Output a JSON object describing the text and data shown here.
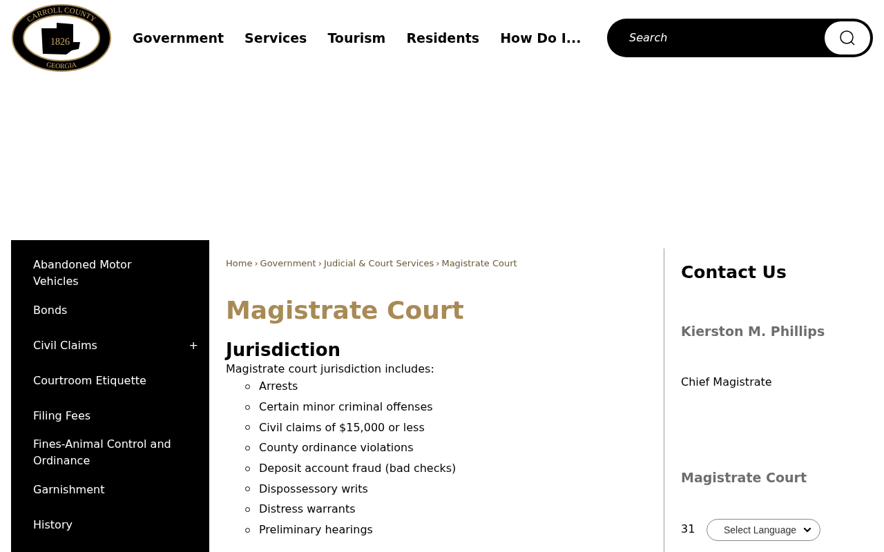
{
  "logo": {
    "top_text": "CARROLL COUNTY",
    "year": "1826",
    "bottom_text": "GEORGIA"
  },
  "nav": [
    "Government",
    "Services",
    "Tourism",
    "Residents",
    "How Do I..."
  ],
  "search": {
    "placeholder": "Search"
  },
  "sidebar": {
    "items": [
      {
        "label": "Abandoned Motor Vehicles"
      },
      {
        "label": "Bonds"
      },
      {
        "label": "Civil Claims",
        "toggle": "+"
      },
      {
        "label": "Courtroom Etiquette"
      },
      {
        "label": "Filing Fees"
      },
      {
        "label": "Fines-Animal Control and Ordinance"
      },
      {
        "label": "Garnishment"
      },
      {
        "label": "History"
      }
    ]
  },
  "breadcrumb": [
    "Home",
    "Government",
    "Judicial & Court Services",
    "Magistrate Court"
  ],
  "breadcrumb_separator": "›",
  "page_title": "Magistrate Court",
  "section": {
    "heading": "Jurisdiction",
    "intro": "Magistrate court jurisdiction includes:",
    "items": [
      "Arrests",
      "Certain minor criminal offenses",
      "Civil claims of $15,000 or less",
      "County ordinance violations",
      "Deposit account fraud (bad checks)",
      "Dispossessory writs",
      "Distress warrants",
      "Preliminary hearings"
    ]
  },
  "contact": {
    "heading": "Contact Us",
    "name": "Kierston M. Phillips",
    "role": "Chief Magistrate",
    "office": "Magistrate Court",
    "address_start": "31"
  },
  "language_select": {
    "label": "Select Language"
  }
}
